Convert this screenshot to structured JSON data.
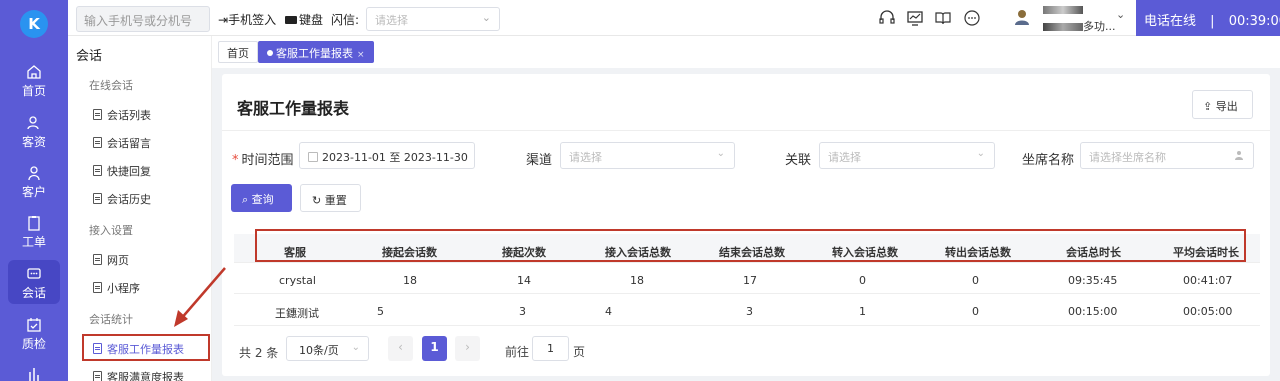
{
  "rail": {
    "items": [
      {
        "label": "首页",
        "icon": "home-icon"
      },
      {
        "label": "客资",
        "icon": "contacts-icon"
      },
      {
        "label": "客户",
        "icon": "customer-icon"
      },
      {
        "label": "工单",
        "icon": "ticket-icon"
      },
      {
        "label": "会话",
        "icon": "chat-icon"
      },
      {
        "label": "质检",
        "icon": "quality-check-icon"
      }
    ],
    "active": "会话"
  },
  "topbar": {
    "phone_placeholder": "输入手机号或分机号",
    "sign_in": "手机签入",
    "keyboard": "键盘",
    "flash_label": "闪信:",
    "flash_placeholder": "请选择",
    "user_suffix": "多功...",
    "status": "电话在线",
    "separator": "|",
    "timer": "00:39:00"
  },
  "subnav": {
    "title": "会话",
    "groups": [
      {
        "label": "在线会话",
        "items": [
          "会话列表",
          "会话留言",
          "快捷回复",
          "会话历史"
        ]
      },
      {
        "label": "接入设置",
        "items": [
          "网页",
          "小程序"
        ]
      },
      {
        "label": "会话统计",
        "items": [
          "客服工作量报表",
          "客服满意度报表"
        ]
      }
    ],
    "active_item": "客服工作量报表"
  },
  "tabs": [
    {
      "label": "首页"
    },
    {
      "label": "客服工作量报表",
      "close": "×"
    }
  ],
  "page": {
    "title": "客服工作量报表",
    "export_label": "导出"
  },
  "filters": {
    "time_range_label": "时间范围",
    "time_range_value": "2023-11-01 至 2023-11-30",
    "channel_label": "渠道",
    "channel_placeholder": "请选择",
    "relation_label": "关联",
    "relation_placeholder": "请选择",
    "agent_label": "坐席名称",
    "agent_placeholder": "请选择坐席名称",
    "query_label": "查询",
    "reset_label": "重置"
  },
  "table": {
    "headers": [
      "客服",
      "接起会话数",
      "接起次数",
      "接入会话总数",
      "结束会话总数",
      "转入会话总数",
      "转出会话总数",
      "会话总时长",
      "平均会话时长"
    ],
    "rows": [
      [
        "crystal",
        "18",
        "14",
        "18",
        "17",
        "0",
        "0",
        "09:35:45",
        "00:41:07"
      ],
      [
        "王鏸测试",
        "5",
        "3",
        "4",
        "3",
        "1",
        "0",
        "00:15:00",
        "00:05:00"
      ]
    ]
  },
  "pager": {
    "total": "共 2 条",
    "page_size": "10条/页",
    "prev": "‹",
    "current": "1",
    "next": "›",
    "goto_label": "前往",
    "goto_value": "1",
    "goto_suffix": "页"
  },
  "colors": {
    "brand": "#5b5bd6",
    "annotation": "#c0392b"
  }
}
